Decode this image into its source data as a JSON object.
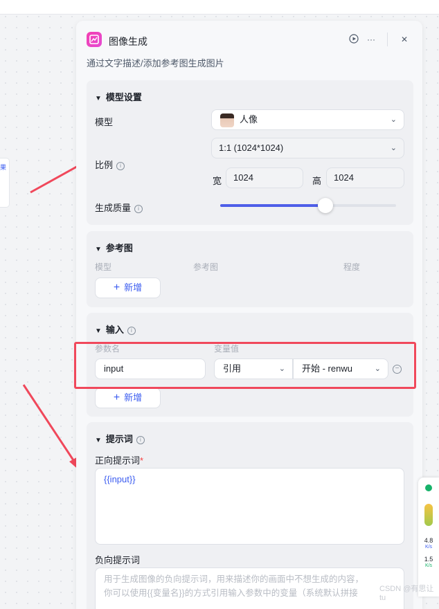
{
  "left_node": {
    "label": "果"
  },
  "panel": {
    "title": "图像生成",
    "subtitle": "通过文字描述/添加参考图生成图片",
    "run_icon": "play-circle-icon",
    "more_icon": "ellipsis-icon",
    "close_icon": "close-icon"
  },
  "model_settings": {
    "title": "模型设置",
    "model_label": "模型",
    "model_value": "人像",
    "ratio_label": "比例",
    "ratio_value": "1:1 (1024*1024)",
    "width_label": "宽",
    "width_value": "1024",
    "height_label": "高",
    "height_value": "1024",
    "quality_label": "生成质量",
    "quality_level": 0.6
  },
  "reference": {
    "title": "参考图",
    "col_model": "模型",
    "col_ref": "参考图",
    "col_degree": "程度",
    "add_label": "新增"
  },
  "input": {
    "title": "输入",
    "param_name_header": "参数名",
    "var_value_header": "变量值",
    "param_name": "input",
    "ref_type": "引用",
    "ref_source": "开始 - renwu",
    "add_label": "新增"
  },
  "prompt": {
    "title": "提示词",
    "positive_label": "正向提示词",
    "required_mark": "*",
    "positive_value": "{{input}}",
    "negative_label": "负向提示词",
    "negative_placeholder_1": "用于生成图像的负向提示词，用来描述你的画面中不想生成的内容，",
    "negative_placeholder_2": "你可以使用{{变量名}}的方式引用输入参数中的变量（系统默认拼接"
  },
  "perf": {
    "up_speed": "4.8",
    "up_unit": "K/s",
    "down_speed": "1.5",
    "down_unit": "K/s"
  },
  "watermark": "CSDN @有思让tu",
  "colors": {
    "accent": "#3b5cf0",
    "highlight": "#f0485b",
    "slider": "#4e5ee8"
  }
}
